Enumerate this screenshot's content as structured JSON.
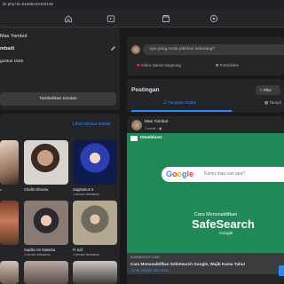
{
  "browser": {
    "url": "ile.php?id=61588410100108"
  },
  "profile": {
    "name": "Mas Yambot",
    "bio": "mbadi",
    "birthday": "gustus 1945",
    "add_highlight_label": "Tambahkan sorotan"
  },
  "friends": {
    "see_all": "Lihat semua teman",
    "items": [
      {
        "name": "",
        "sub": "a"
      },
      {
        "name": "Chelbi Oktavia",
        "sub": ""
      },
      {
        "name": "Sagittarius 5",
        "sub": "1 teman bersama"
      },
      {
        "name": "",
        "sub": ""
      },
      {
        "name": "Saptila Sri Matatna",
        "sub": "1 teman bersama"
      },
      {
        "name": "Fi Saf",
        "sub": "1 teman bersama"
      }
    ]
  },
  "composer": {
    "placeholder": "Apa yang Anda pikirkan sekarang?",
    "live_label": "Video siaran langsung",
    "photo_label": "Foto/video"
  },
  "posts": {
    "title": "Postingan",
    "filter_label": "Filter",
    "tab_list": "Tampilan Daftar",
    "tab_grid": "Tampil",
    "post": {
      "author": "Mas Yambot",
      "time": "1 menit",
      "ad_brand": "IDwebhost",
      "search_google": "Google",
      "search_placeholder": "Kamu mau cari apa?",
      "caption_top": "Cara Menonaktifkan",
      "caption_big": "SafeSearch",
      "caption_sub": "Google",
      "link_domain": "IDWEBHOST.COM",
      "link_title": "Cara Menonaktifkan SafeSearch Google, Wajib Kamu Tahu!",
      "insight_label": "Lihat insight dan iklan"
    }
  },
  "colors": {
    "accent": "#2d88ff",
    "ad_bg": "#1f8a57",
    "live_red": "#f02849",
    "photo_green": "#45bd62"
  }
}
